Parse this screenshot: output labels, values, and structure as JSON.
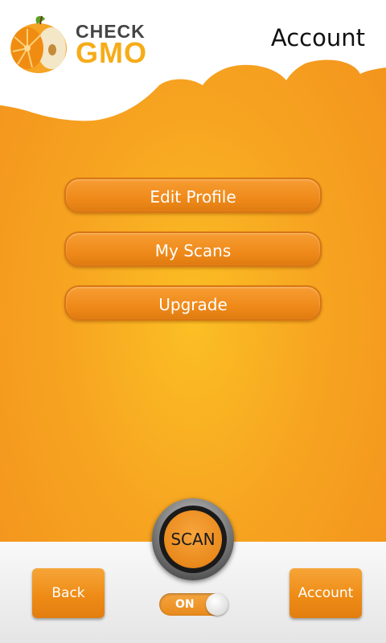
{
  "header": {
    "logo_word1": "CHECK",
    "logo_word2": "GMO",
    "title": "Account"
  },
  "menu": {
    "items": [
      {
        "label": "Edit Profile"
      },
      {
        "label": "My Scans"
      },
      {
        "label": "Upgrade"
      }
    ]
  },
  "bottom": {
    "back_label": "Back",
    "account_label": "Account",
    "scan_label": "SCAN",
    "toggle_label": "ON"
  },
  "colors": {
    "accent": "#f7a521",
    "button": "#ef8a1a"
  }
}
